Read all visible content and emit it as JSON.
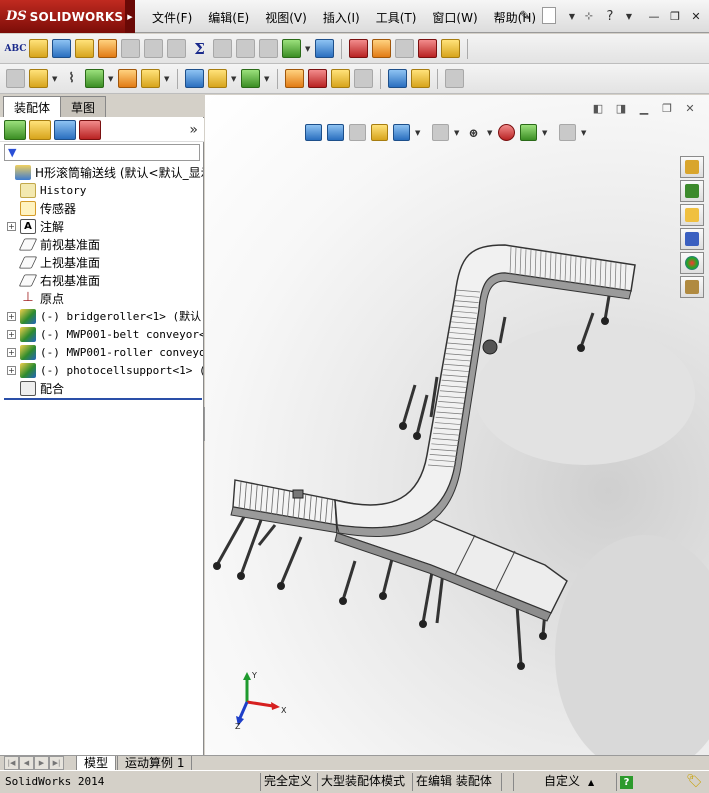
{
  "app": {
    "logo_ds": "DS",
    "logo_brand": "SOLIDWORKS",
    "menus": [
      "文件(F)",
      "编辑(E)",
      "视图(V)",
      "插入(I)",
      "工具(T)",
      "窗口(W)",
      "帮助(H)"
    ]
  },
  "feature_manager": {
    "tabs": [
      "装配体",
      "草图"
    ],
    "tree": [
      {
        "label": "H形滚筒输送线  (默认<默认_显示",
        "icon": "assembly-icon",
        "expander": "none",
        "mono": false
      },
      {
        "label": "History",
        "icon": "history-icon",
        "expander": "none",
        "mono": true
      },
      {
        "label": "传感器",
        "icon": "sensor-icon",
        "expander": "none",
        "mono": false
      },
      {
        "label": "注解",
        "icon": "annotation-icon",
        "expander": "+",
        "mono": false
      },
      {
        "label": "前视基准面",
        "icon": "plane-icon",
        "expander": "none",
        "mono": false
      },
      {
        "label": "上视基准面",
        "icon": "plane-icon",
        "expander": "none",
        "mono": false
      },
      {
        "label": "右视基准面",
        "icon": "plane-icon",
        "expander": "none",
        "mono": false
      },
      {
        "label": "原点",
        "icon": "origin-icon",
        "expander": "none",
        "mono": false
      },
      {
        "label": "(-) bridgeroller<1> (默认)",
        "icon": "part-icon",
        "expander": "+",
        "mono": true
      },
      {
        "label": "(-) MWP001-belt conveyor<1",
        "icon": "part-icon",
        "expander": "+",
        "mono": true
      },
      {
        "label": "(-) MWP001-roller conveyor",
        "icon": "part-icon",
        "expander": "+",
        "mono": true
      },
      {
        "label": "(-) photocellsupport<1> (默",
        "icon": "part-icon",
        "expander": "+",
        "mono": true
      },
      {
        "label": "配合",
        "icon": "mates-icon",
        "expander": "none",
        "mono": false
      }
    ]
  },
  "bottom_tabs": [
    "模型",
    "运动算例 1"
  ],
  "status": {
    "app_version": "SolidWorks 2014",
    "fully_defined": "完全定义",
    "large_assembly": "大型装配体模式",
    "editing": "在编辑 装配体",
    "custom": "自定义",
    "help": "?"
  },
  "triad": {
    "x": "X",
    "y": "Y",
    "z": "Z"
  },
  "colors": {
    "logo_red": "#9b1a12",
    "selection_blue": "#2a4fa8",
    "triad_x": "#d62020",
    "triad_y": "#1e9a2e",
    "triad_z": "#1e3ec8"
  }
}
